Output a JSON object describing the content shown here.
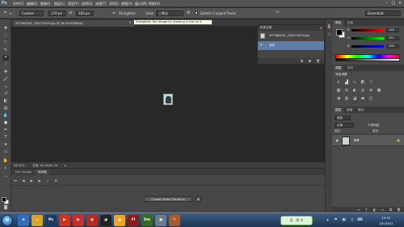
{
  "menubar": {
    "logo": "Ps",
    "items": [
      "文件(F)",
      "编辑(E)",
      "图像(I)",
      "图层(L)",
      "类型(Y)",
      "选择(S)",
      "滤镜(T)",
      "3D(D)",
      "视图(V)",
      "窗口(W)",
      "帮助(H)"
    ],
    "window_controls": [
      "–",
      "□",
      "×"
    ]
  },
  "options_bar": {
    "tool_icon": "crop-tool-icon",
    "preset": "Custom",
    "width": "170 px",
    "height": "183 px",
    "swap_icon": "swap-icon",
    "straighten_label": "Straighten",
    "view_label": "View:",
    "view_value": "三等分",
    "delete_cropped_label": "Delete Cropped Pixels",
    "reset_icon": "reset-icon",
    "workspace": "Essentials"
  },
  "document": {
    "tab_title": "337566234_700073029.jpg @ 26.5%(RGB/8#)",
    "tab_close": "×"
  },
  "tooltip": {
    "text": "Straighten the image by drawing a line on it"
  },
  "history_panel": {
    "title": "历史记录",
    "rows": [
      {
        "text": "337566234_700073029.jpg"
      },
      {
        "text": "裁剪"
      }
    ]
  },
  "status_bar": {
    "zoom": "26.47%",
    "doc": "文档: 92.1K/92.1K"
  },
  "timeline": {
    "tabs": [
      "Mini Bridge",
      "时间轴"
    ],
    "create_button": "Create Video Timeline",
    "dropdown_icon": "▾"
  },
  "color_panel": {
    "tabs": [
      "颜色",
      "色板"
    ],
    "sliders": [
      {
        "label": "R",
        "value": "128",
        "gradient": "linear-gradient(to right,#000,#f00)"
      },
      {
        "label": "G",
        "value": "222",
        "gradient": "linear-gradient(to right,#000,#0f0)"
      },
      {
        "label": "B",
        "value": "206",
        "gradient": "linear-gradient(to right,#000,#00f)"
      }
    ]
  },
  "adjustments_panel": {
    "tabs": [
      "调整",
      "样式"
    ],
    "title": "添加调整"
  },
  "layers_panel": {
    "tabs": [
      "图层",
      "通道",
      "路径"
    ],
    "kind_label": "类型",
    "blend_mode": "正常",
    "opacity_label": "不透明度:",
    "lock_label": "锁定:",
    "fill_label": "填充:",
    "layer_name": "背景"
  },
  "taskbar": {
    "apps": [
      {
        "label": "e",
        "color": "#2f6fbf"
      },
      {
        "label": "▭",
        "color": "#d9a528"
      },
      {
        "label": "Ps",
        "color": "#1d3b5e"
      },
      {
        "label": "▶",
        "color": "#d1321e"
      },
      {
        "label": "▶",
        "color": "#c9302c"
      },
      {
        "label": "◉",
        "color": "#b8281e"
      },
      {
        "label": "◕",
        "color": "#222"
      },
      {
        "label": "◕",
        "color": "#f2a41a"
      },
      {
        "label": "Fl",
        "color": "#8a1d16"
      },
      {
        "label": "Dw",
        "color": "#356a1f"
      },
      {
        "label": "▣",
        "color": "#6a7b8e"
      },
      {
        "label": "✎",
        "color": "#a85c2d"
      }
    ],
    "ime": "英 ·,简 ⚙",
    "time": "15:41",
    "date": "2014/5/1"
  }
}
